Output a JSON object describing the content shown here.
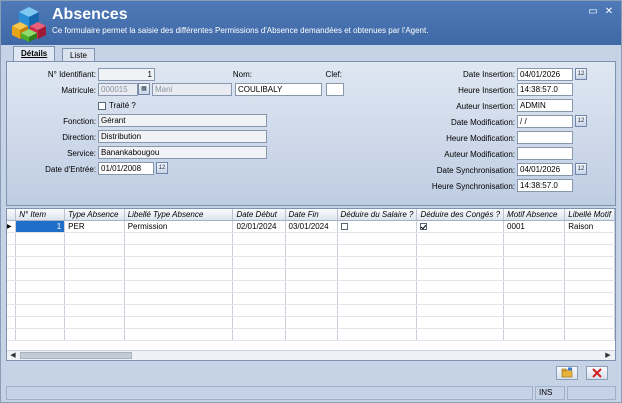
{
  "window": {
    "title": "Absences",
    "subtitle": "Ce formulaire permet la saisie des différentes Permissions d'Absence demandées et obtenues par l'Agent.",
    "minimize_glyph": "▭",
    "close_glyph": "✕"
  },
  "tabs": [
    {
      "label": "Détails",
      "active": true
    },
    {
      "label": "Liste",
      "active": false
    }
  ],
  "form": {
    "identifiant": {
      "label": "N° Identifiant:",
      "value": "1"
    },
    "matricule": {
      "label": "Matricule:",
      "value": "000015",
      "prenom": "Mani"
    },
    "nom": {
      "label": "Nom:",
      "value": "COULIBALY"
    },
    "clef": {
      "label": "Clef:",
      "value": ""
    },
    "traite": {
      "label": "Traité ?",
      "checked": false
    },
    "fonction": {
      "label": "Fonction:",
      "value": "Gérant"
    },
    "direction": {
      "label": "Direction:",
      "value": "Distribution"
    },
    "service": {
      "label": "Service:",
      "value": "Banankabougou"
    },
    "date_entree": {
      "label": "Date d'Entrée:",
      "value": "01/01/2008"
    },
    "date_insertion": {
      "label": "Date Insertion:",
      "value": "04/01/2026"
    },
    "heure_insertion": {
      "label": "Heure Insertion:",
      "value": "14:38:57.0"
    },
    "auteur_insertion": {
      "label": "Auteur Insertion:",
      "value": "ADMIN"
    },
    "date_modification": {
      "label": "Date Modification:",
      "value": " / /"
    },
    "heure_modification": {
      "label": "Heure Modification:",
      "value": ""
    },
    "auteur_modification": {
      "label": "Auteur Modification:",
      "value": ""
    },
    "date_synchronisation": {
      "label": "Date Synchronisation:",
      "value": "04/01/2026"
    },
    "heure_synchronisation": {
      "label": "Heure Synchronisation:",
      "value": "14:38:57.0"
    },
    "calendar_glyph": "12"
  },
  "grid": {
    "columns": [
      "N° Item",
      "Type Absence",
      "Libellé Type Absence",
      "Date Début",
      "Date Fin",
      "Déduire du Salaire ?",
      "Déduire des Congés ?",
      "Motif Absence",
      "Libellé Motif"
    ],
    "rows": [
      {
        "item": "1",
        "type": "PER",
        "libelle": "Permission",
        "debut": "02/01/2024",
        "fin": "03/01/2024",
        "deduire_salaire": false,
        "deduire_conges": true,
        "motif": "0001",
        "libelle_motif": "Raison"
      }
    ],
    "row_marker": "▶",
    "scroll_left": "◀",
    "scroll_right": "▶"
  },
  "statusbar": {
    "mode": "INS"
  },
  "colors": {
    "header": "#4572b2",
    "panel": "#d3ddeb",
    "selection": "#1f6fc9"
  }
}
